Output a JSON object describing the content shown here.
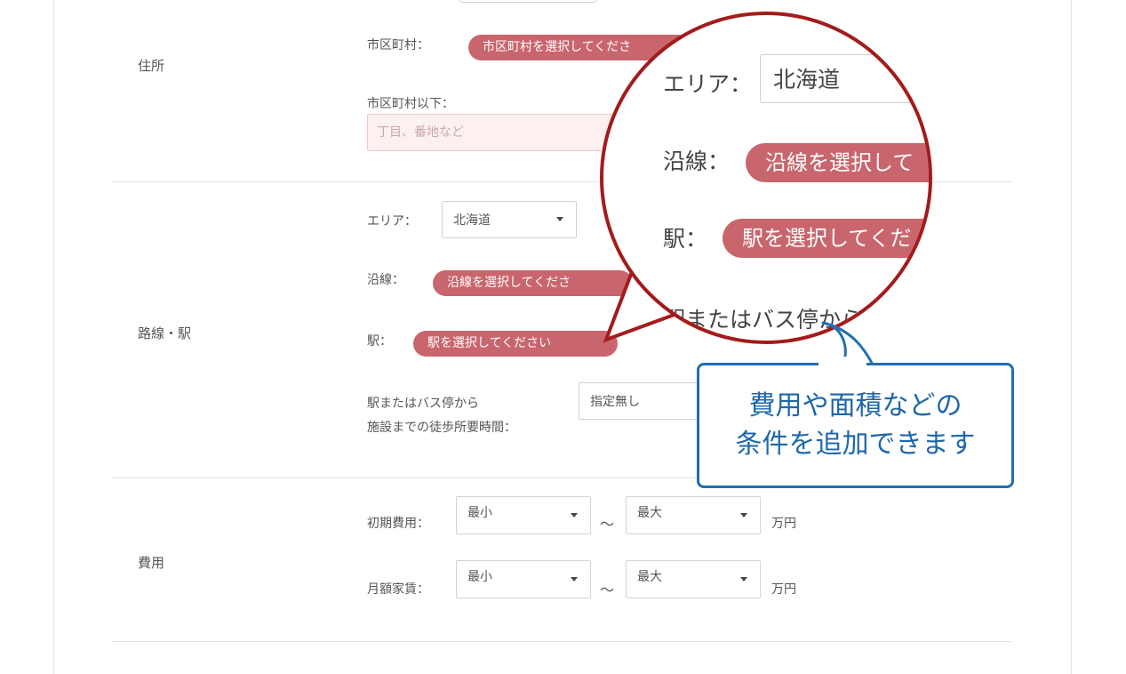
{
  "address": {
    "section_label": "住所",
    "city_label": "市区町村：",
    "city_pill": "市区町村を選択してくださ",
    "below_city_label": "市区町村以下：",
    "below_city_placeholder": "丁目、番地など"
  },
  "route": {
    "section_label": "路線・駅",
    "area_label": "エリア：",
    "area_value": "北海道",
    "line_label": "沿線：",
    "line_pill": "沿線を選択してくださ",
    "station_label": "駅：",
    "station_pill": "駅を選択してください",
    "walk_label_line1": "駅またはバス停から",
    "walk_label_line2": "施設までの徒歩所要時間：",
    "walk_value": "指定無し"
  },
  "cost": {
    "section_label": "費用",
    "initial_label": "初期費用：",
    "monthly_label": "月額家賃：",
    "min_value": "最小",
    "max_value": "最大",
    "tilde": "～",
    "unit": "万円"
  },
  "magnifier": {
    "area_label": "エリア：",
    "area_value": "北海道",
    "line_label": "沿線：",
    "line_pill": "沿線を選択して",
    "station_label": "駅：",
    "station_pill": "駅を選択してくだ",
    "walk_partial": "駅またはバス停から"
  },
  "tooltip": {
    "line1": "費用や面積などの",
    "line2": "条件を追加できます"
  },
  "colors": {
    "pill": "#c9656c",
    "magnifier_ring": "#a31b1b",
    "tooltip_blue": "#1f6fb2"
  }
}
